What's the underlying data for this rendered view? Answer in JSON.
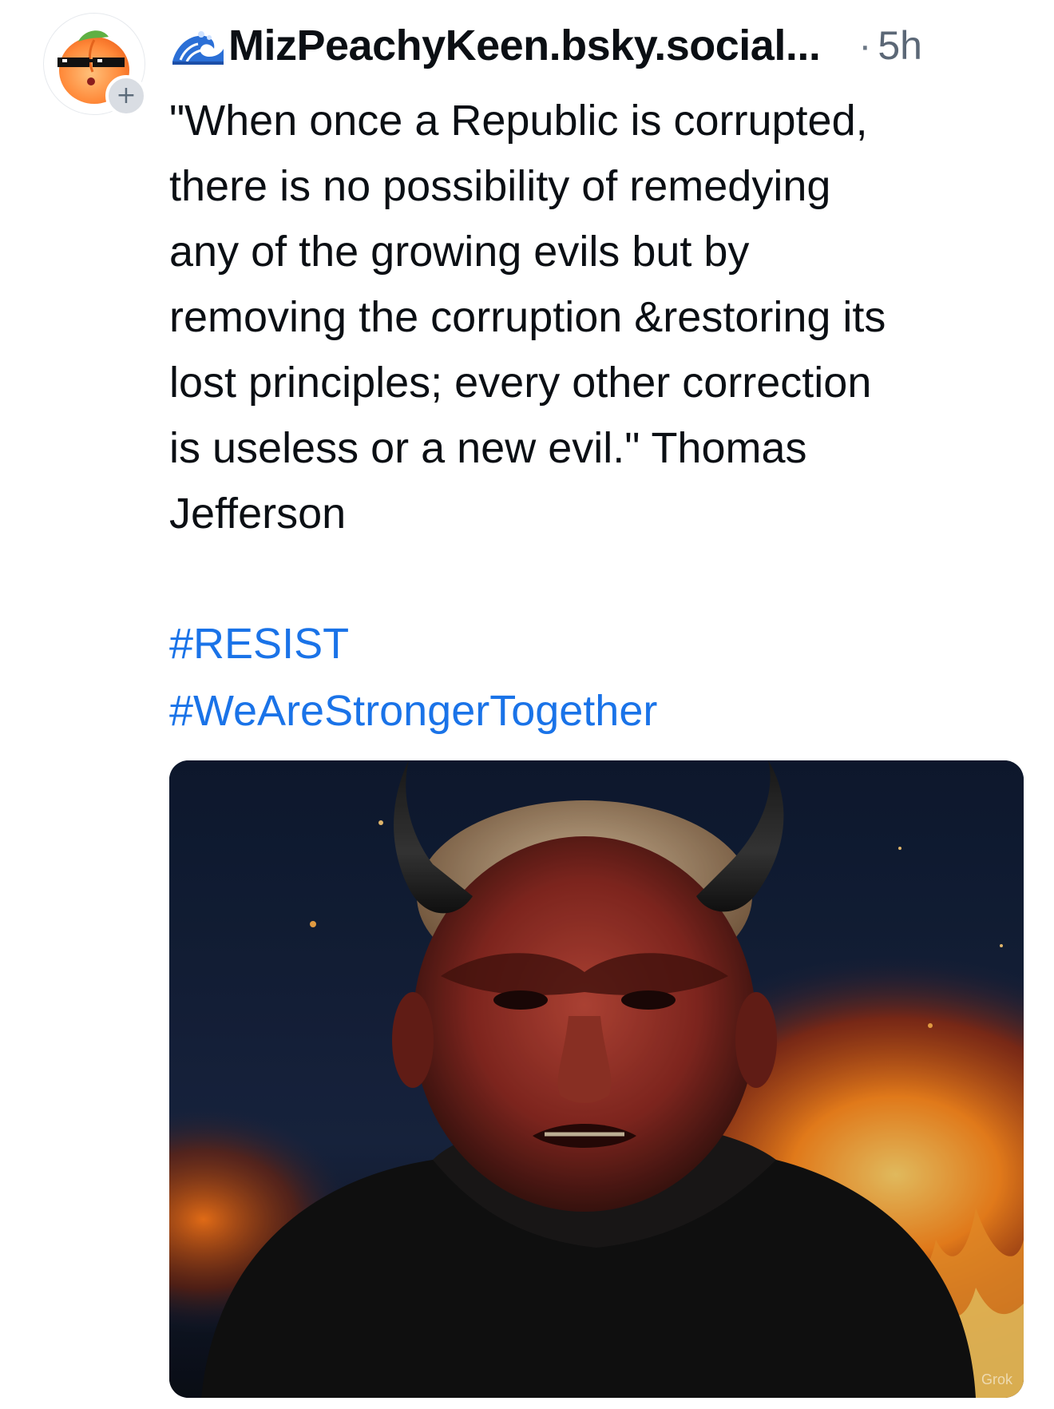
{
  "post": {
    "display_name": "MizPeachyKeen.bsky.social...",
    "separator": "·",
    "timestamp": "5h",
    "follow_label": "+",
    "text": "\"When once a Republic is corrupted,\nthere is no possibility of remedying\nany of the growing evils but by\nremoving the corruption &restoring its\nlost principles; every other correction\nis useless or a new evil.\" Thomas\nJefferson",
    "hashtags": [
      "#RESIST",
      "#WeAreStrongerTogether"
    ],
    "image_watermark": "Grok"
  },
  "colors": {
    "hashtag": "#1a73e8",
    "timestamp": "#5b6776",
    "text": "#0b0f14"
  }
}
